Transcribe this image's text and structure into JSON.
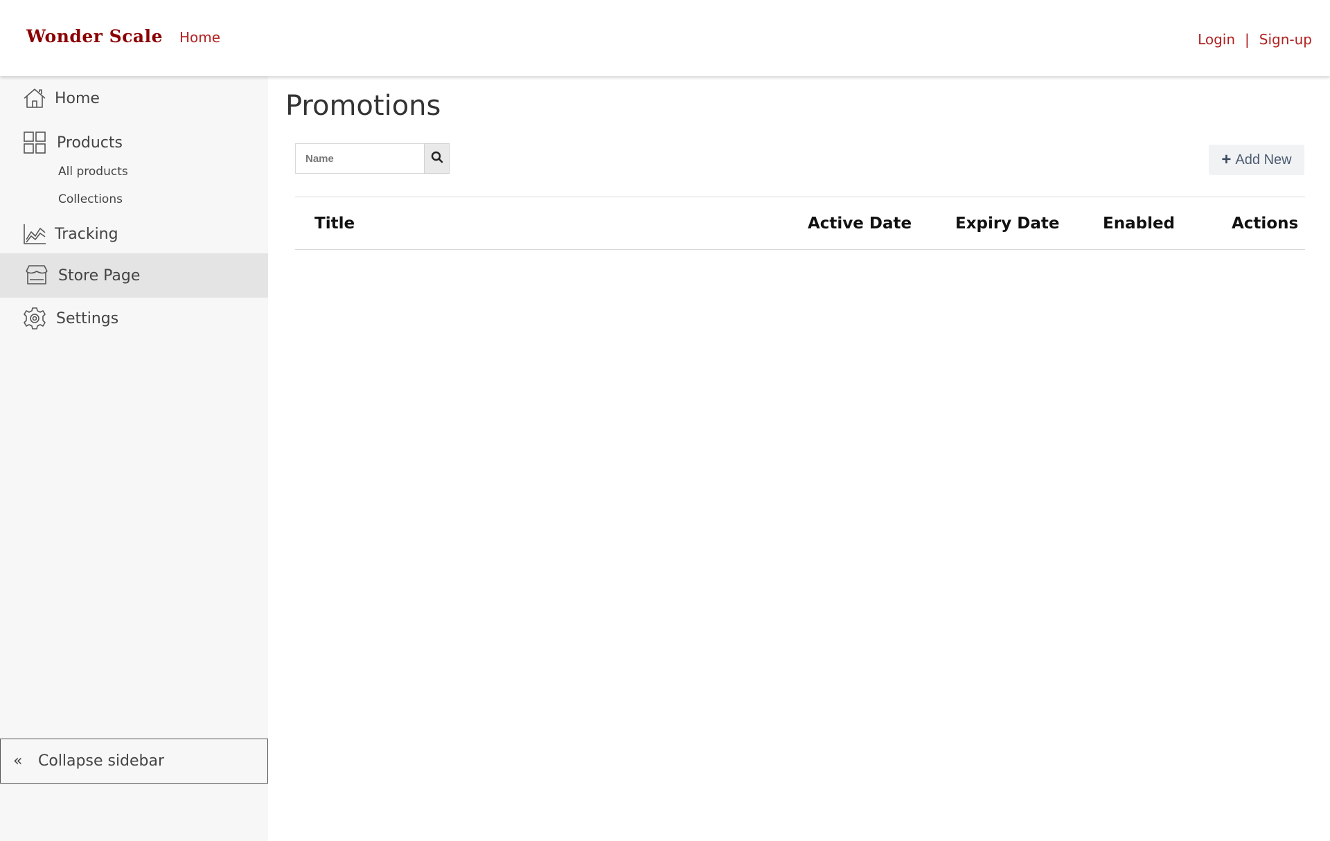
{
  "header": {
    "brand": "Wonder Scale",
    "nav_home": "Home",
    "login": "Login",
    "separator": "|",
    "signup": "Sign-up"
  },
  "sidebar": {
    "items": [
      {
        "label": "Home",
        "icon": "home-icon"
      },
      {
        "label": "Products",
        "icon": "grid-icon"
      },
      {
        "label": "Tracking",
        "icon": "chart-icon"
      },
      {
        "label": "Store Page",
        "icon": "store-icon",
        "active": true
      },
      {
        "label": "Settings",
        "icon": "gear-icon"
      }
    ],
    "sub_items": [
      "All products",
      "Collections"
    ],
    "collapse_chevron": "«",
    "collapse_label": "Collapse sidebar"
  },
  "main": {
    "title": "Promotions",
    "search": {
      "placeholder": "Name",
      "value": ""
    },
    "add_button": "Add New",
    "table": {
      "columns": [
        "Title",
        "Active Date",
        "Expiry Date",
        "Enabled",
        "Actions"
      ],
      "rows": []
    }
  },
  "colors": {
    "brand": "#8b0000",
    "link": "#b22222",
    "sidebar_bg": "#f7f7f7",
    "sidebar_active": "#e4e4e4"
  }
}
